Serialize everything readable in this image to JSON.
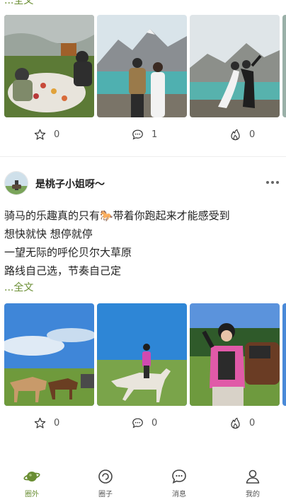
{
  "feed": {
    "post1": {
      "more_label": "...全文",
      "photos": [
        "riverside-picnic-photo",
        "mountain-lake-couple-photo",
        "mountain-lake-pose-photo"
      ],
      "actions": {
        "star_count": "0",
        "comment_count": "1",
        "like_count": "0"
      }
    },
    "post2": {
      "username": "是桃子小姐呀～",
      "lines": [
        "骑马的乐趣真的只有🐎带着你跑起来才能感受到",
        "想快就快  想停就停",
        "一望无际的呼伦贝尔大草原",
        "路线自己选，节奏自己定"
      ],
      "more_label": "...全文",
      "photos": [
        "saddled-horses-photo",
        "horse-rider-grassland-photo",
        "girl-with-horse-photo"
      ],
      "actions": {
        "star_count": "0",
        "comment_count": "0",
        "like_count": "0"
      }
    }
  },
  "tabbar": {
    "items": [
      {
        "label": "圈外",
        "icon": "planet-icon",
        "active": true
      },
      {
        "label": "圈子",
        "icon": "circle-icon",
        "active": false
      },
      {
        "label": "消息",
        "icon": "message-icon",
        "active": false
      },
      {
        "label": "我的",
        "icon": "user-icon",
        "active": false
      }
    ]
  },
  "colors": {
    "accent": "#6a8e33",
    "text": "#222222",
    "muted": "#555555"
  }
}
